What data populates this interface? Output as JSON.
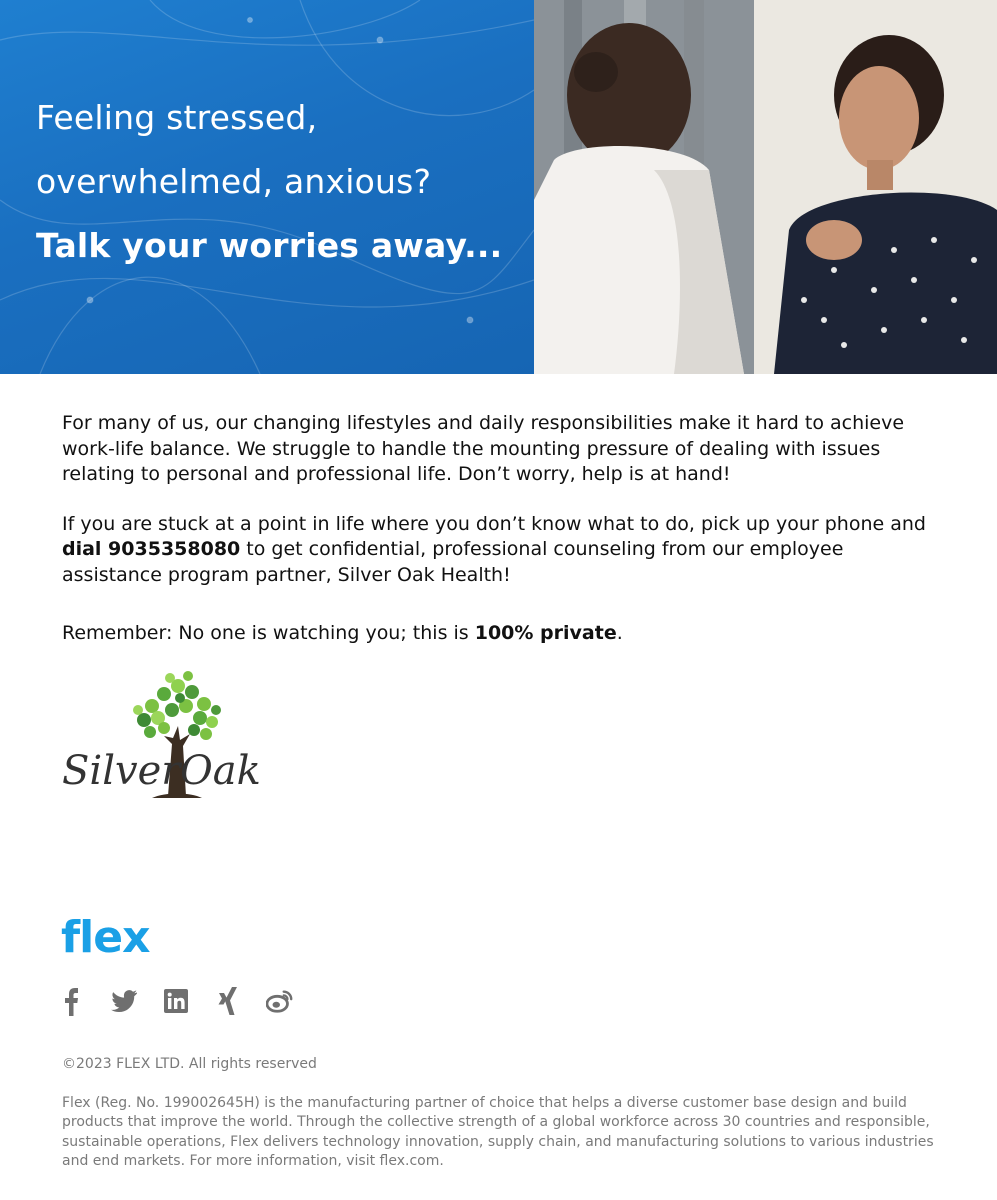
{
  "hero": {
    "line1": "Feeling stressed,",
    "line2": "overwhelmed, anxious?",
    "line3": "Talk your worries away..."
  },
  "body": {
    "p1": "For many of us, our changing lifestyles and daily responsibilities make it hard to achieve work-life balance. We struggle to handle the mounting pressure of dealing with issues relating to personal and professional life. Don’t worry, help is at hand!",
    "p2_before": "If you are stuck at a point in life where you don’t know what to do, pick up your phone and ",
    "p2_bold": "dial 9035358080",
    "p2_after": " to get confidential, professional counseling from our employee assistance program partner, Silver Oak Health!",
    "p3_before": "Remember: No one is watching you; this is ",
    "p3_bold": "100% private",
    "p3_after": "."
  },
  "partner_logo": {
    "word1": "Silver",
    "word2": "Oak"
  },
  "footer": {
    "brand": "flex",
    "social_icons": [
      "facebook-icon",
      "twitter-icon",
      "linkedin-icon",
      "xing-icon",
      "weibo-icon"
    ],
    "copyright": "©2023 FLEX LTD. All rights reserved",
    "about": "Flex (Reg. No. 199002645H) is the manufacturing partner of choice that helps a diverse customer base design and build products that improve the world. Through the collective strength of a global workforce across 30 countries and responsible, sustainable operations, Flex delivers technology innovation, supply chain, and manufacturing solutions to various industries and end markets. For more information, visit flex.com."
  },
  "colors": {
    "banner_blue": "#1a6fc0",
    "flex_brand": "#1aa0e6",
    "footer_text": "#7a7a7a",
    "icon_gray": "#6f6f6f"
  }
}
